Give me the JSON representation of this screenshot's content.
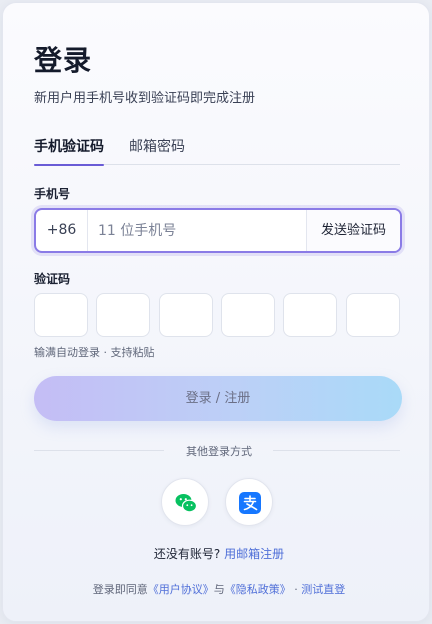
{
  "header": {
    "title": "登录",
    "subtitle": "新用户用手机号收到验证码即完成注册"
  },
  "tabs": [
    {
      "label": "手机验证码",
      "active": true
    },
    {
      "label": "邮箱密码",
      "active": false
    }
  ],
  "phone": {
    "label": "手机号",
    "prefix": "+86",
    "placeholder": "11 位手机号",
    "value": "",
    "send_code_label": "发送验证码"
  },
  "code": {
    "label": "验证码",
    "digits": [
      "",
      "",
      "",
      "",
      "",
      ""
    ],
    "hint": "输满自动登录 · 支持粘贴"
  },
  "submit_label": "登录 / 注册",
  "divider_label": "其他登录方式",
  "social": {
    "wechat_icon": "wechat-icon",
    "alipay_icon": "alipay-icon"
  },
  "signup": {
    "prompt": "还没有账号?",
    "link": "用邮箱注册"
  },
  "footer": {
    "prefix": "登录即同意",
    "user_agreement": "《用户协议》",
    "and": "与",
    "privacy_policy": "《隐私政策》",
    "separator": "·",
    "test_login": "测试直登"
  },
  "colors": {
    "accent": "#6a5cd6",
    "link": "#4f6fd8",
    "wechat": "#07c160",
    "alipay": "#1677ff"
  }
}
